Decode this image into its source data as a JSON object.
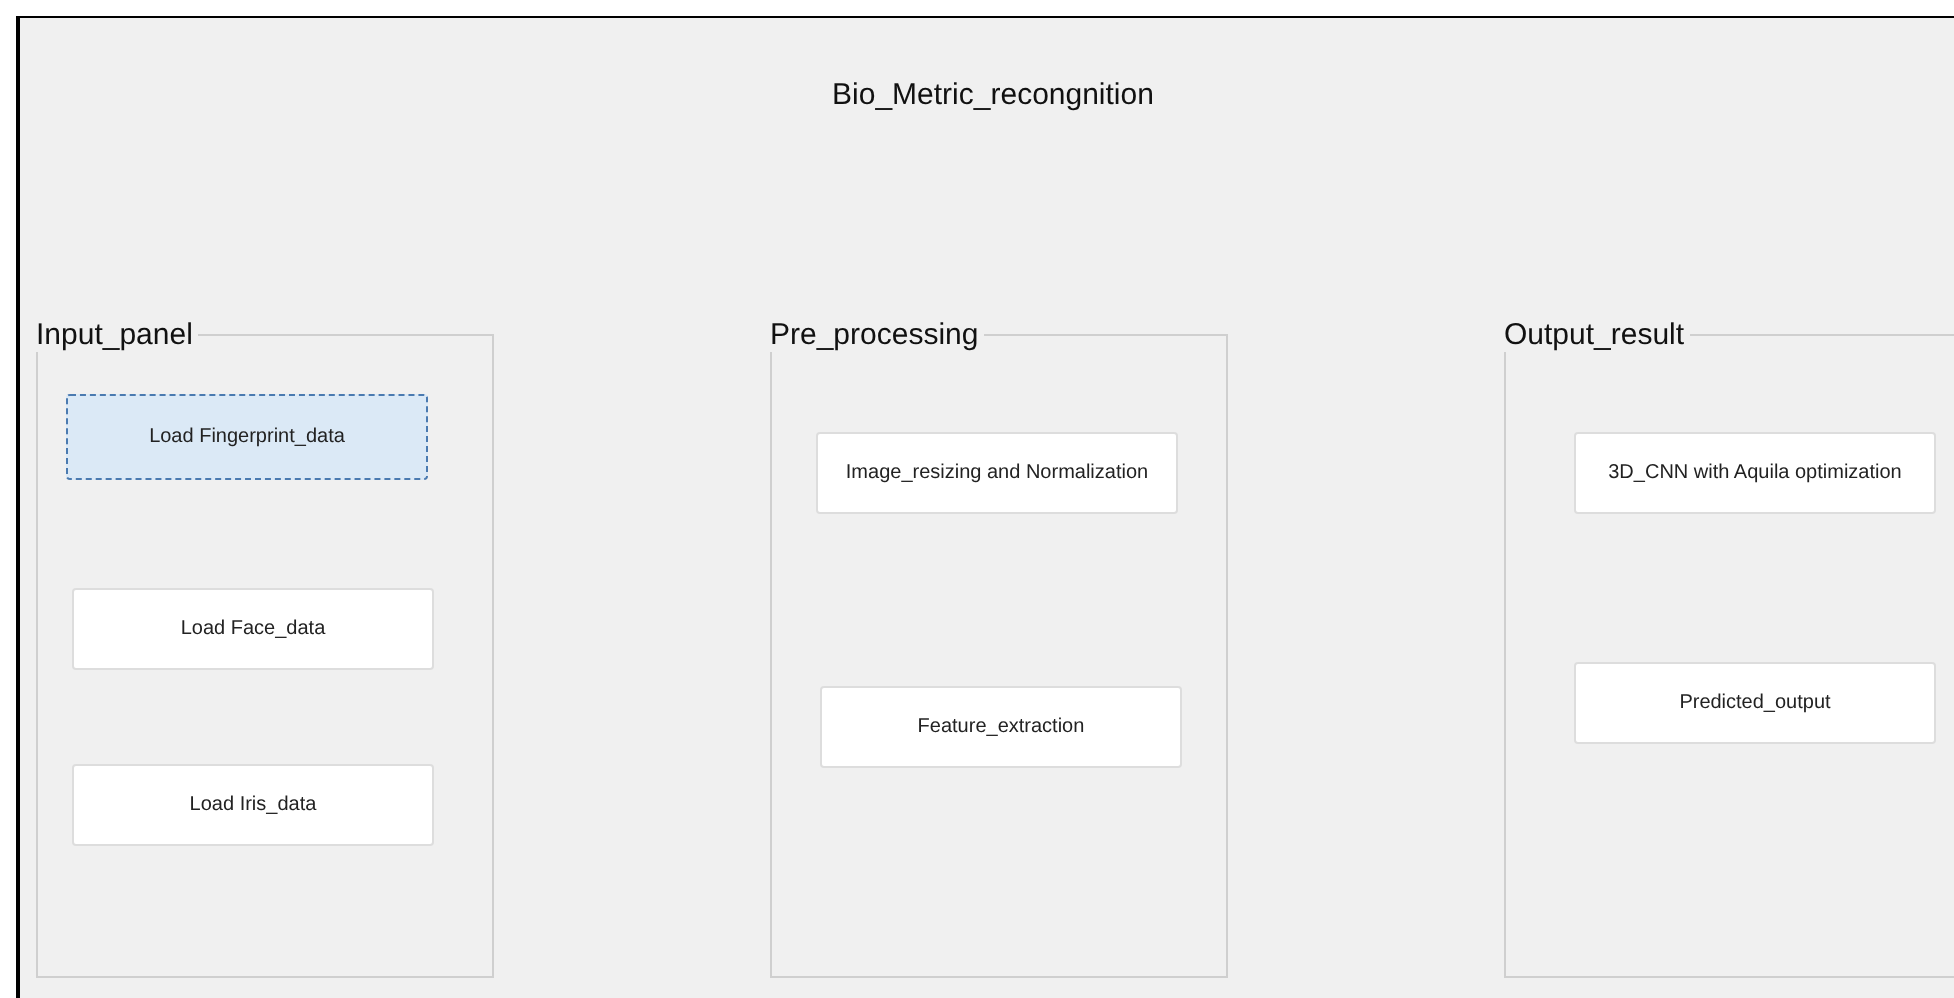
{
  "window": {
    "title": "Bio_Metric_recongnition"
  },
  "panels": [
    {
      "title": "Input_panel",
      "buttons": [
        {
          "label": "Load Fingerprint_data",
          "selected": true
        },
        {
          "label": "Load Face_data",
          "selected": false
        },
        {
          "label": "Load Iris_data",
          "selected": false
        }
      ]
    },
    {
      "title": "Pre_processing",
      "buttons": [
        {
          "label": "Image_resizing and Normalization",
          "selected": false
        },
        {
          "label": "Feature_extraction",
          "selected": false
        }
      ]
    },
    {
      "title": "Output_result",
      "buttons": [
        {
          "label": "3D_CNN with Aquila optimization",
          "selected": false
        },
        {
          "label": "Predicted_output",
          "selected": false
        }
      ]
    }
  ]
}
